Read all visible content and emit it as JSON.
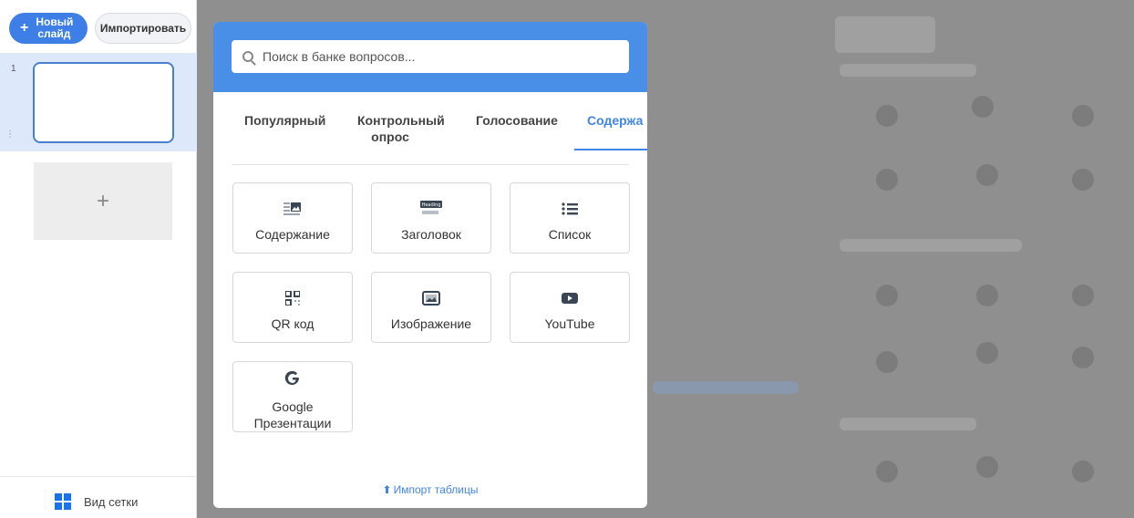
{
  "sidebar": {
    "new_slide_label": "Новый слайд",
    "import_label": "Импортировать",
    "slide_number": "1",
    "add_slide_symbol": "+",
    "grid_view_label": "Вид сетки"
  },
  "modal": {
    "search_placeholder": "Поиск в банке вопросов...",
    "tabs": [
      {
        "label": "Популярный"
      },
      {
        "label": "Контрольный опрос"
      },
      {
        "label": "Голосование"
      },
      {
        "label": "Содержа"
      }
    ],
    "active_tab": "Содержа",
    "cards": [
      {
        "label": "Содержание",
        "icon": "text-image-icon"
      },
      {
        "label": "Заголовок",
        "icon": "heading-icon"
      },
      {
        "label": "Список",
        "icon": "list-icon"
      },
      {
        "label": "QR код",
        "icon": "qr-code-icon"
      },
      {
        "label": "Изображение",
        "icon": "image-icon"
      },
      {
        "label": "YouTube",
        "icon": "youtube-icon"
      },
      {
        "label": "Google Презентации",
        "icon": "google-icon"
      }
    ],
    "heading_icon_text": "Heading",
    "import_table_label": "Импорт таблицы"
  },
  "colors": {
    "accent": "#3f86e6",
    "header": "#4a8fe7",
    "overlay": "#8f8f8f"
  }
}
